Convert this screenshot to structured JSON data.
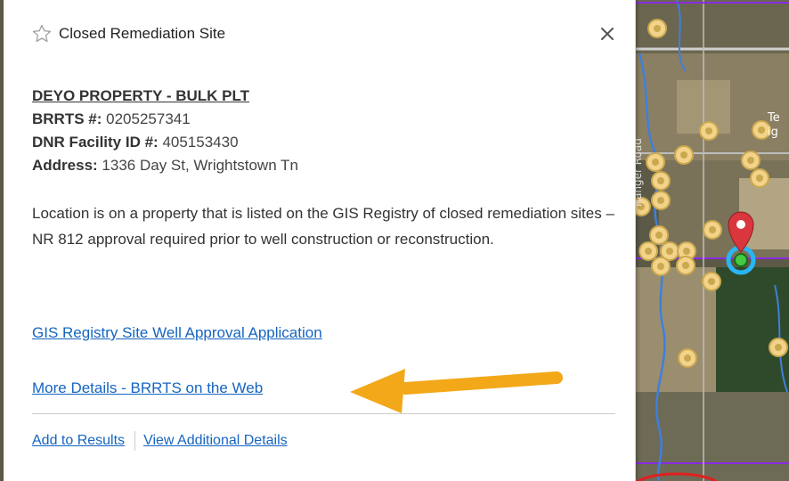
{
  "popup": {
    "title": "Closed Remediation Site",
    "site_name": "DEYO PROPERTY - BULK PLT",
    "fields": [
      {
        "label": "BRRTS #:",
        "value": "0205257341"
      },
      {
        "label": "DNR Facility ID #:",
        "value": "405153430"
      },
      {
        "label": "Address:",
        "value": "1336 Day St, Wrightstown Tn"
      }
    ],
    "description": "Location is on a property that is listed on the GIS Registry of closed remediation sites – NR 812 approval required prior to well construction or reconstruction.",
    "links": {
      "gis_registry": "GIS Registry Site Well Approval Application",
      "brrts_web": "More Details - BRRTS on the Web"
    },
    "footer": {
      "add_to_results": "Add to Results",
      "view_details": "View Additional Details"
    }
  },
  "map": {
    "road_label": "Ranger Road",
    "edge_labels": [
      "Te",
      "ig"
    ]
  },
  "colors": {
    "link": "#1565c0",
    "arrow": "#f2a818",
    "marker_red": "#d9363e",
    "marker_cyan": "#29b6f6",
    "marker_green": "#43c943",
    "site_dot": "#f3d38a",
    "water": "#3f7fdc",
    "boundary": "#8a2be2"
  },
  "icons": {
    "favorite": "star-outline-icon",
    "close": "close-icon",
    "annotation": "arrow-left-icon",
    "location": "map-pin-icon"
  }
}
